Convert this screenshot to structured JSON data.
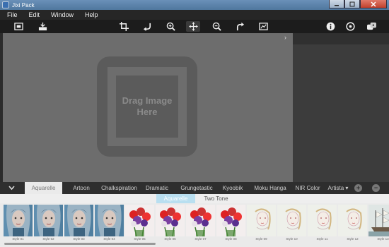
{
  "window": {
    "title": "Jixi Pack"
  },
  "menu": [
    "File",
    "Edit",
    "Window",
    "Help"
  ],
  "toolbar": {
    "left_tools": [
      "fit-image-icon",
      "open-image-icon"
    ],
    "center_tools": [
      "crop-icon",
      "undo-icon",
      "zoom-in-icon",
      "pan-move-icon",
      "zoom-out-icon",
      "redo-icon",
      "compare-icon"
    ],
    "right_tools": [
      "info-icon",
      "settings-icon",
      "share-icon"
    ],
    "active_tool": "pan-move-icon"
  },
  "canvas": {
    "drop_text_line1": "Drag Image",
    "drop_text_line2": "Here",
    "panel_toggle": "›"
  },
  "style_tabs": {
    "collapse": "⌄",
    "tabs": [
      "Aquarelle",
      "Artoon",
      "Chalkspiration",
      "Dramatic",
      "Grungetastic",
      "Kyoobik",
      "Moku Hanga",
      "NIR Color",
      "Artista ▾"
    ],
    "active": "Aquarelle",
    "add_button": "+",
    "remove_button": "−"
  },
  "subtabs": {
    "items": [
      "Aquarelle",
      "Two Tone"
    ],
    "active": "Aquarelle"
  },
  "thumbnails": [
    {
      "label": "Style 01",
      "kind": "portrait"
    },
    {
      "label": "Style 02",
      "kind": "portrait"
    },
    {
      "label": "Style 03",
      "kind": "portrait"
    },
    {
      "label": "Style 04",
      "kind": "portrait"
    },
    {
      "label": "Style 05",
      "kind": "flowers"
    },
    {
      "label": "Style 06",
      "kind": "flowers"
    },
    {
      "label": "Style 07",
      "kind": "flowers"
    },
    {
      "label": "Style 08",
      "kind": "flowers"
    },
    {
      "label": "Style 09",
      "kind": "sketch"
    },
    {
      "label": "Style 10",
      "kind": "sketch"
    },
    {
      "label": "Style 11",
      "kind": "sketch"
    },
    {
      "label": "Style 12",
      "kind": "sketch"
    },
    {
      "label": "Style 13",
      "kind": "ship"
    }
  ],
  "colors": {
    "canvas": "#6d6d6d",
    "panel": "#3c3c3c",
    "subtab_active": "#b9dff0",
    "tab_active": "#eaeaea"
  }
}
